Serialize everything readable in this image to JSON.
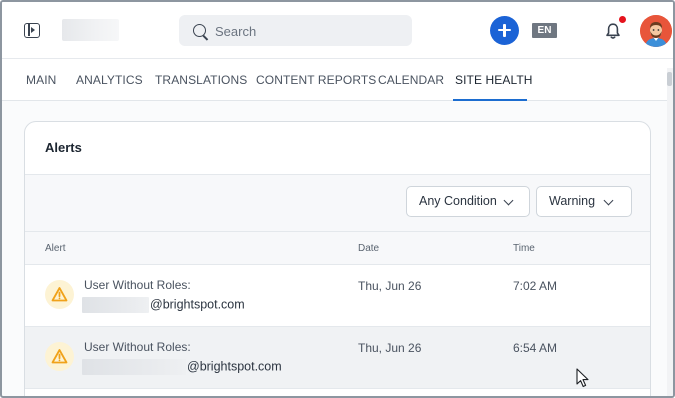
{
  "header": {
    "search_placeholder": "Search",
    "language": "EN"
  },
  "tabs": [
    {
      "label": "MAIN",
      "active": false
    },
    {
      "label": "ANALYTICS",
      "active": false
    },
    {
      "label": "TRANSLATIONS",
      "active": false
    },
    {
      "label": "CONTENT REPORTS",
      "active": false
    },
    {
      "label": "CALENDAR",
      "active": false
    },
    {
      "label": "SITE HEALTH",
      "active": true
    }
  ],
  "alerts": {
    "title": "Alerts",
    "filters": {
      "condition": "Any Condition",
      "severity": "Warning"
    },
    "columns": {
      "alert": "Alert",
      "date": "Date",
      "time": "Time"
    },
    "rows": [
      {
        "title": "User Without Roles:",
        "email_domain": "@brightspot.com",
        "date": "Thu, Jun 26",
        "time": "7:02 AM",
        "highlighted": false
      },
      {
        "title": "User Without Roles:",
        "email_domain": "@brightspot.com",
        "date": "Thu, Jun 26",
        "time": "6:54 AM",
        "highlighted": true
      }
    ]
  },
  "colors": {
    "accent": "#1b63d6",
    "active_tab_underline": "#1c6dd0",
    "warning_icon": "#f0a21a",
    "notification_dot": "#e5131d"
  },
  "icons": [
    "sidebar-toggle-icon",
    "search-icon",
    "plus-icon",
    "bell-icon",
    "warning-icon",
    "chevron-down-icon"
  ]
}
